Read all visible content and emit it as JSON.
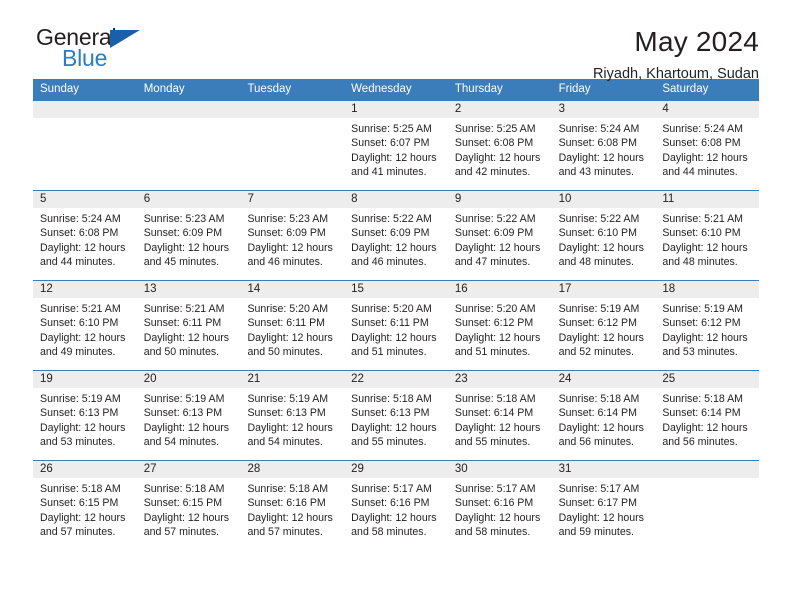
{
  "brand": {
    "name_top": "General",
    "name_bottom": "Blue",
    "triangle_color": "#1a5fa8",
    "blue_color": "#2b7cc4"
  },
  "header": {
    "title": "May 2024",
    "subtitle": "Riyadh, Khartoum, Sudan",
    "accent_color": "#3b7cba",
    "daynum_band_color": "#ededed"
  },
  "calendar": {
    "weekdays": [
      "Sunday",
      "Monday",
      "Tuesday",
      "Wednesday",
      "Thursday",
      "Friday",
      "Saturday"
    ],
    "weeks": [
      [
        {
          "day": "",
          "sunrise": "",
          "sunset": "",
          "daylight_line1": "",
          "daylight_line2": ""
        },
        {
          "day": "",
          "sunrise": "",
          "sunset": "",
          "daylight_line1": "",
          "daylight_line2": ""
        },
        {
          "day": "",
          "sunrise": "",
          "sunset": "",
          "daylight_line1": "",
          "daylight_line2": ""
        },
        {
          "day": "1",
          "sunrise": "Sunrise: 5:25 AM",
          "sunset": "Sunset: 6:07 PM",
          "daylight_line1": "Daylight: 12 hours",
          "daylight_line2": "and 41 minutes."
        },
        {
          "day": "2",
          "sunrise": "Sunrise: 5:25 AM",
          "sunset": "Sunset: 6:08 PM",
          "daylight_line1": "Daylight: 12 hours",
          "daylight_line2": "and 42 minutes."
        },
        {
          "day": "3",
          "sunrise": "Sunrise: 5:24 AM",
          "sunset": "Sunset: 6:08 PM",
          "daylight_line1": "Daylight: 12 hours",
          "daylight_line2": "and 43 minutes."
        },
        {
          "day": "4",
          "sunrise": "Sunrise: 5:24 AM",
          "sunset": "Sunset: 6:08 PM",
          "daylight_line1": "Daylight: 12 hours",
          "daylight_line2": "and 44 minutes."
        }
      ],
      [
        {
          "day": "5",
          "sunrise": "Sunrise: 5:24 AM",
          "sunset": "Sunset: 6:08 PM",
          "daylight_line1": "Daylight: 12 hours",
          "daylight_line2": "and 44 minutes."
        },
        {
          "day": "6",
          "sunrise": "Sunrise: 5:23 AM",
          "sunset": "Sunset: 6:09 PM",
          "daylight_line1": "Daylight: 12 hours",
          "daylight_line2": "and 45 minutes."
        },
        {
          "day": "7",
          "sunrise": "Sunrise: 5:23 AM",
          "sunset": "Sunset: 6:09 PM",
          "daylight_line1": "Daylight: 12 hours",
          "daylight_line2": "and 46 minutes."
        },
        {
          "day": "8",
          "sunrise": "Sunrise: 5:22 AM",
          "sunset": "Sunset: 6:09 PM",
          "daylight_line1": "Daylight: 12 hours",
          "daylight_line2": "and 46 minutes."
        },
        {
          "day": "9",
          "sunrise": "Sunrise: 5:22 AM",
          "sunset": "Sunset: 6:09 PM",
          "daylight_line1": "Daylight: 12 hours",
          "daylight_line2": "and 47 minutes."
        },
        {
          "day": "10",
          "sunrise": "Sunrise: 5:22 AM",
          "sunset": "Sunset: 6:10 PM",
          "daylight_line1": "Daylight: 12 hours",
          "daylight_line2": "and 48 minutes."
        },
        {
          "day": "11",
          "sunrise": "Sunrise: 5:21 AM",
          "sunset": "Sunset: 6:10 PM",
          "daylight_line1": "Daylight: 12 hours",
          "daylight_line2": "and 48 minutes."
        }
      ],
      [
        {
          "day": "12",
          "sunrise": "Sunrise: 5:21 AM",
          "sunset": "Sunset: 6:10 PM",
          "daylight_line1": "Daylight: 12 hours",
          "daylight_line2": "and 49 minutes."
        },
        {
          "day": "13",
          "sunrise": "Sunrise: 5:21 AM",
          "sunset": "Sunset: 6:11 PM",
          "daylight_line1": "Daylight: 12 hours",
          "daylight_line2": "and 50 minutes."
        },
        {
          "day": "14",
          "sunrise": "Sunrise: 5:20 AM",
          "sunset": "Sunset: 6:11 PM",
          "daylight_line1": "Daylight: 12 hours",
          "daylight_line2": "and 50 minutes."
        },
        {
          "day": "15",
          "sunrise": "Sunrise: 5:20 AM",
          "sunset": "Sunset: 6:11 PM",
          "daylight_line1": "Daylight: 12 hours",
          "daylight_line2": "and 51 minutes."
        },
        {
          "day": "16",
          "sunrise": "Sunrise: 5:20 AM",
          "sunset": "Sunset: 6:12 PM",
          "daylight_line1": "Daylight: 12 hours",
          "daylight_line2": "and 51 minutes."
        },
        {
          "day": "17",
          "sunrise": "Sunrise: 5:19 AM",
          "sunset": "Sunset: 6:12 PM",
          "daylight_line1": "Daylight: 12 hours",
          "daylight_line2": "and 52 minutes."
        },
        {
          "day": "18",
          "sunrise": "Sunrise: 5:19 AM",
          "sunset": "Sunset: 6:12 PM",
          "daylight_line1": "Daylight: 12 hours",
          "daylight_line2": "and 53 minutes."
        }
      ],
      [
        {
          "day": "19",
          "sunrise": "Sunrise: 5:19 AM",
          "sunset": "Sunset: 6:13 PM",
          "daylight_line1": "Daylight: 12 hours",
          "daylight_line2": "and 53 minutes."
        },
        {
          "day": "20",
          "sunrise": "Sunrise: 5:19 AM",
          "sunset": "Sunset: 6:13 PM",
          "daylight_line1": "Daylight: 12 hours",
          "daylight_line2": "and 54 minutes."
        },
        {
          "day": "21",
          "sunrise": "Sunrise: 5:19 AM",
          "sunset": "Sunset: 6:13 PM",
          "daylight_line1": "Daylight: 12 hours",
          "daylight_line2": "and 54 minutes."
        },
        {
          "day": "22",
          "sunrise": "Sunrise: 5:18 AM",
          "sunset": "Sunset: 6:13 PM",
          "daylight_line1": "Daylight: 12 hours",
          "daylight_line2": "and 55 minutes."
        },
        {
          "day": "23",
          "sunrise": "Sunrise: 5:18 AM",
          "sunset": "Sunset: 6:14 PM",
          "daylight_line1": "Daylight: 12 hours",
          "daylight_line2": "and 55 minutes."
        },
        {
          "day": "24",
          "sunrise": "Sunrise: 5:18 AM",
          "sunset": "Sunset: 6:14 PM",
          "daylight_line1": "Daylight: 12 hours",
          "daylight_line2": "and 56 minutes."
        },
        {
          "day": "25",
          "sunrise": "Sunrise: 5:18 AM",
          "sunset": "Sunset: 6:14 PM",
          "daylight_line1": "Daylight: 12 hours",
          "daylight_line2": "and 56 minutes."
        }
      ],
      [
        {
          "day": "26",
          "sunrise": "Sunrise: 5:18 AM",
          "sunset": "Sunset: 6:15 PM",
          "daylight_line1": "Daylight: 12 hours",
          "daylight_line2": "and 57 minutes."
        },
        {
          "day": "27",
          "sunrise": "Sunrise: 5:18 AM",
          "sunset": "Sunset: 6:15 PM",
          "daylight_line1": "Daylight: 12 hours",
          "daylight_line2": "and 57 minutes."
        },
        {
          "day": "28",
          "sunrise": "Sunrise: 5:18 AM",
          "sunset": "Sunset: 6:16 PM",
          "daylight_line1": "Daylight: 12 hours",
          "daylight_line2": "and 57 minutes."
        },
        {
          "day": "29",
          "sunrise": "Sunrise: 5:17 AM",
          "sunset": "Sunset: 6:16 PM",
          "daylight_line1": "Daylight: 12 hours",
          "daylight_line2": "and 58 minutes."
        },
        {
          "day": "30",
          "sunrise": "Sunrise: 5:17 AM",
          "sunset": "Sunset: 6:16 PM",
          "daylight_line1": "Daylight: 12 hours",
          "daylight_line2": "and 58 minutes."
        },
        {
          "day": "31",
          "sunrise": "Sunrise: 5:17 AM",
          "sunset": "Sunset: 6:17 PM",
          "daylight_line1": "Daylight: 12 hours",
          "daylight_line2": "and 59 minutes."
        },
        {
          "day": "",
          "sunrise": "",
          "sunset": "",
          "daylight_line1": "",
          "daylight_line2": ""
        }
      ]
    ]
  }
}
